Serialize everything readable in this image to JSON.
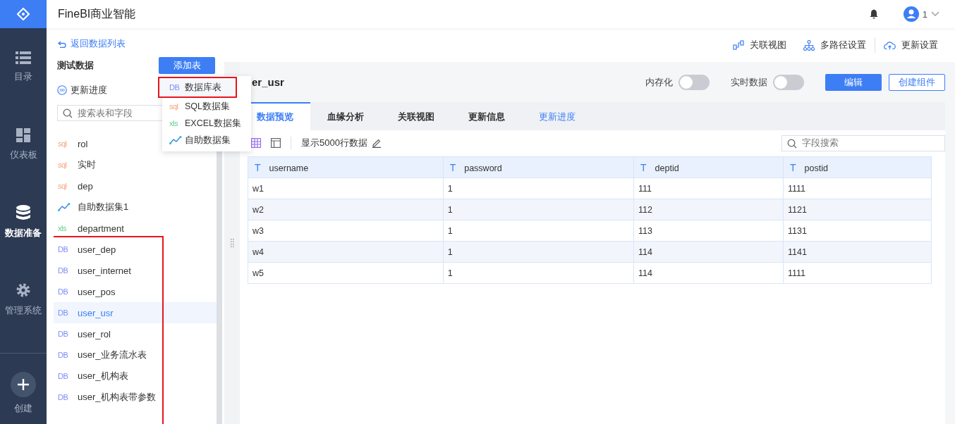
{
  "app": {
    "title": "FineBI商业智能",
    "user": "1"
  },
  "nav": [
    {
      "label": "目录",
      "selected": false
    },
    {
      "label": "仪表板",
      "selected": false
    },
    {
      "label": "数据准备",
      "selected": true
    },
    {
      "label": "管理系统",
      "selected": false
    }
  ],
  "create": {
    "label": "创建"
  },
  "left_panel": {
    "back_link": "返回数据列表",
    "package_title": "测试数据",
    "add_button": "添加表",
    "update_progress": "更新进度",
    "search": {
      "placeholder": "搜索表和字段"
    },
    "groups": [
      {
        "highlighted": false,
        "items": [
          {
            "name": "rol",
            "kind": "sql",
            "badge": "sql",
            "selected": false
          },
          {
            "name": "实时",
            "kind": "sql",
            "badge": "sql",
            "selected": false
          },
          {
            "name": "dep",
            "kind": "sql",
            "badge": "sql",
            "selected": false
          },
          {
            "name": "自助数据集1",
            "kind": "self",
            "selected": false
          },
          {
            "name": "department",
            "kind": "excel",
            "badge": "xls",
            "selected": false
          }
        ]
      },
      {
        "highlighted": true,
        "items": [
          {
            "name": "user_dep",
            "kind": "db",
            "badge": "DB",
            "selected": false
          },
          {
            "name": "user_internet",
            "kind": "db",
            "badge": "DB",
            "selected": false
          },
          {
            "name": "user_pos",
            "kind": "db",
            "badge": "DB",
            "selected": false
          },
          {
            "name": "user_usr",
            "kind": "db",
            "badge": "DB",
            "selected": true
          },
          {
            "name": "user_rol",
            "kind": "db",
            "badge": "DB",
            "selected": false
          },
          {
            "name": "user_业务流水表",
            "kind": "db",
            "badge": "DB",
            "selected": false
          },
          {
            "name": "user_机构表",
            "kind": "db",
            "badge": "DB",
            "selected": false
          },
          {
            "name": "user_机构表带参数",
            "kind": "db",
            "badge": "DB",
            "selected": false
          }
        ]
      }
    ]
  },
  "add_menu": [
    {
      "label": "数据库表",
      "kind": "db",
      "badge": "DB",
      "highlighted": true
    },
    {
      "label": "SQL数据集",
      "kind": "sql",
      "badge": "sql",
      "highlighted": false
    },
    {
      "label": "EXCEL数据集",
      "kind": "excel",
      "badge": "xls",
      "highlighted": false
    },
    {
      "label": "自助数据集",
      "kind": "self",
      "highlighted": false
    }
  ],
  "toolbar": [
    {
      "label": "关联视图"
    },
    {
      "label": "多路径设置"
    },
    {
      "label": "更新设置"
    }
  ],
  "table_header": {
    "name": "er_usr",
    "switches": [
      {
        "label": "内存化",
        "on": false
      },
      {
        "label": "实时数据",
        "on": false
      }
    ],
    "edit_button": "编辑",
    "create_button": "创建组件"
  },
  "tabs": [
    {
      "label": "数据预览",
      "selected": true,
      "kind": "tab"
    },
    {
      "label": "血缘分析",
      "selected": false,
      "kind": "tab"
    },
    {
      "label": "关联视图",
      "selected": false,
      "kind": "tab"
    },
    {
      "label": "更新信息",
      "selected": false,
      "kind": "tab"
    },
    {
      "label": "更新进度",
      "selected": false,
      "kind": "link"
    }
  ],
  "preview": {
    "rows_label": "显示5000行数据",
    "search": {
      "placeholder": "字段搜索"
    },
    "columns": [
      {
        "type": "T",
        "name": "username"
      },
      {
        "type": "T",
        "name": "password"
      },
      {
        "type": "T",
        "name": "deptid"
      },
      {
        "type": "T",
        "name": "postid"
      }
    ],
    "rows": [
      [
        "w1",
        "1",
        "111",
        "1111"
      ],
      [
        "w2",
        "1",
        "112",
        "1121"
      ],
      [
        "w3",
        "1",
        "113",
        "1131"
      ],
      [
        "w4",
        "1",
        "114",
        "1141"
      ],
      [
        "w5",
        "1",
        "114",
        "1111"
      ]
    ]
  }
}
